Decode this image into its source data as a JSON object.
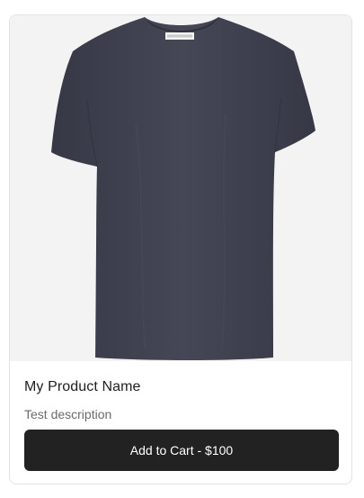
{
  "product": {
    "name": "My Product Name",
    "description": "Test description",
    "image_icon": "tshirt-image",
    "shirt_color": "#3f4150",
    "background_color": "#f3f3f3"
  },
  "cart": {
    "button_label": "Add to Cart - $100",
    "button_color": "#222222"
  }
}
